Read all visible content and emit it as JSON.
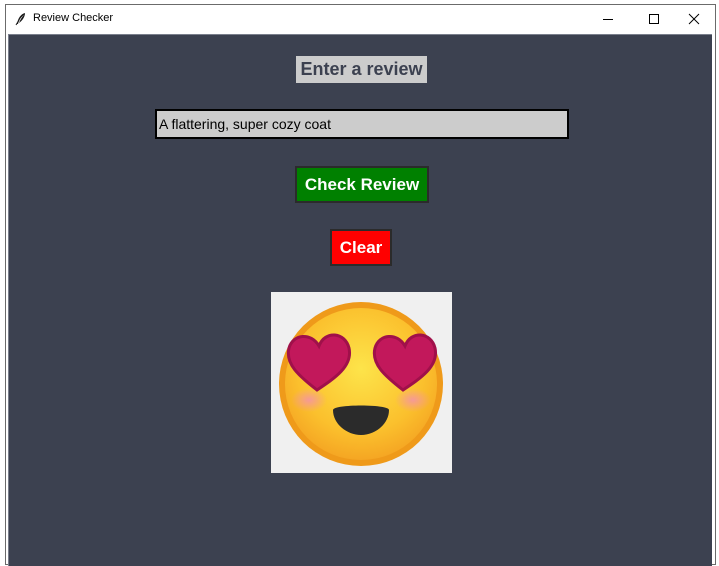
{
  "window": {
    "title": "Review Checker",
    "controls": [
      "minimize-icon",
      "maximize-icon",
      "close-icon"
    ]
  },
  "main": {
    "heading": "Enter a review",
    "review_input": {
      "value": "A flattering, super cozy coat",
      "placeholder": ""
    },
    "check_button_label": "Check Review",
    "clear_button_label": "Clear",
    "result_icon": "smiling-face-with-heart-eyes-icon"
  },
  "colors": {
    "background": "#3c4150",
    "heading_bg": "#cccccc",
    "input_bg": "#cccccc",
    "check_button": "#008000",
    "clear_button": "#ff0000",
    "emoji_panel": "#f0f0f0"
  }
}
